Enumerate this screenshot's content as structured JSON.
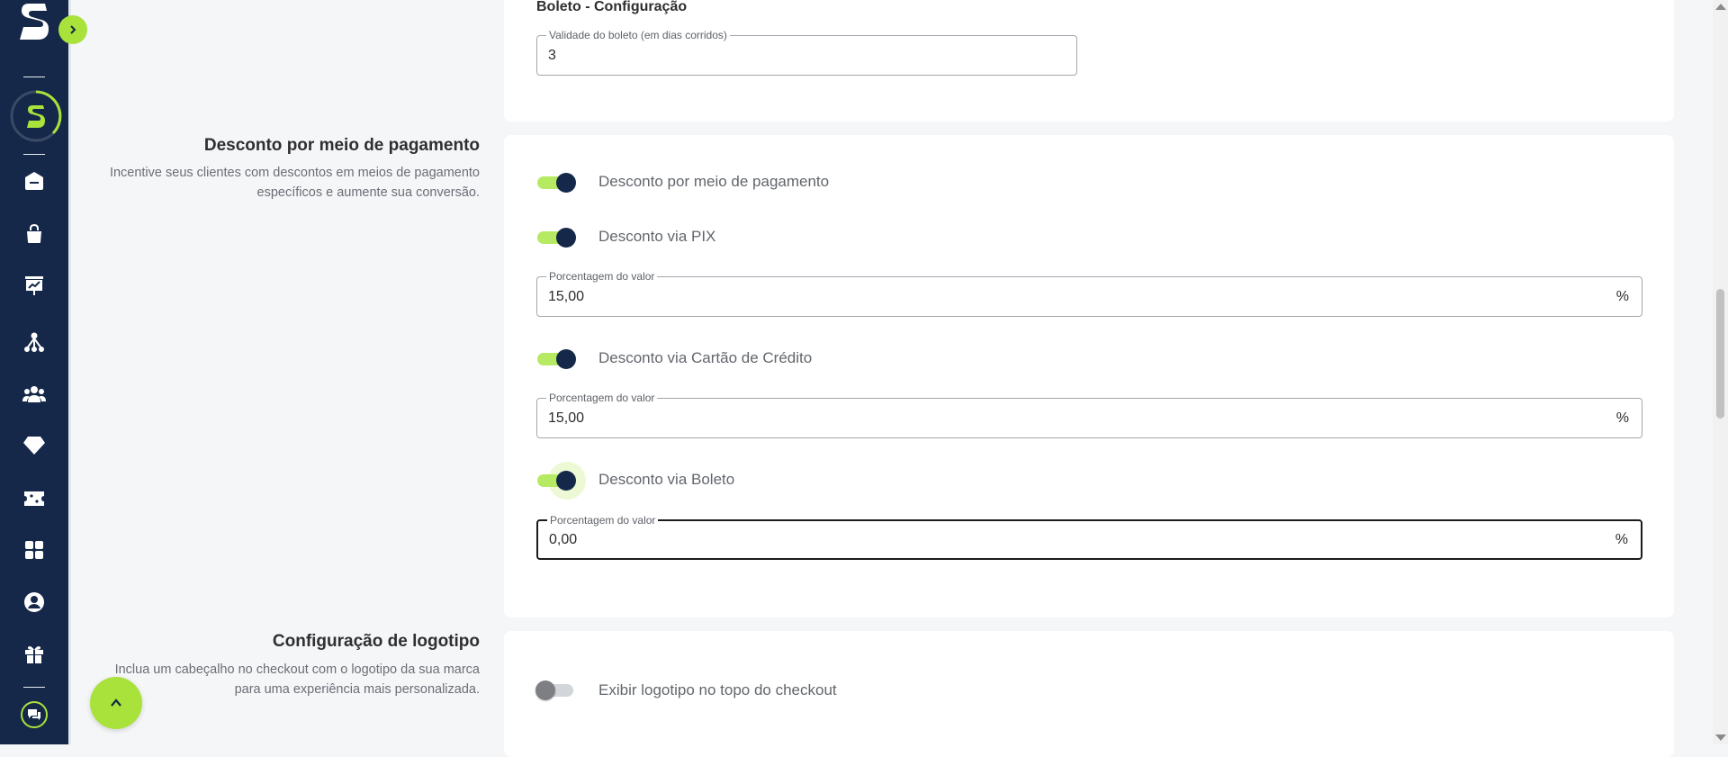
{
  "colors": {
    "sidebar_bg": "#15284a",
    "accent": "#a8e23a",
    "page_bg": "#f5f6f8"
  },
  "sidebar": {
    "icons": [
      "home-icon",
      "shopping-bag-icon",
      "presentation-chart-icon",
      "network-icon",
      "users-icon",
      "diamond-icon",
      "ticket-icon",
      "apps-grid-icon",
      "user-circle-icon",
      "gift-icon",
      "chat-icon"
    ]
  },
  "boleto_config": {
    "title": "Boleto - Configuração",
    "validity_field": {
      "label": "Validade do boleto (em dias corridos)",
      "value": "3"
    }
  },
  "discount_section": {
    "title": "Desconto por meio de pagamento",
    "description": "Incentive seus clientes com descontos em meios de pagamento específicos e aumente sua conversão.",
    "main_toggle": {
      "label": "Desconto por meio de pagamento",
      "on": true
    },
    "pix": {
      "toggle_label": "Desconto via PIX",
      "on": true,
      "field_label": "Porcentagem do valor",
      "value": "15,00",
      "suffix": "%"
    },
    "card": {
      "toggle_label": "Desconto via Cartão de Crédito",
      "on": true,
      "field_label": "Porcentagem do valor",
      "value": "15,00",
      "suffix": "%"
    },
    "boleto": {
      "toggle_label": "Desconto via Boleto",
      "on": true,
      "field_label": "Porcentagem do valor",
      "value": "0,00",
      "suffix": "%"
    }
  },
  "logo_section": {
    "title": "Configuração de logotipo",
    "description": "Inclua um cabeçalho no checkout com o logotipo da sua marca para uma experiência mais personalizada.",
    "toggle": {
      "label": "Exibir logotipo no topo do checkout",
      "on": false
    }
  }
}
